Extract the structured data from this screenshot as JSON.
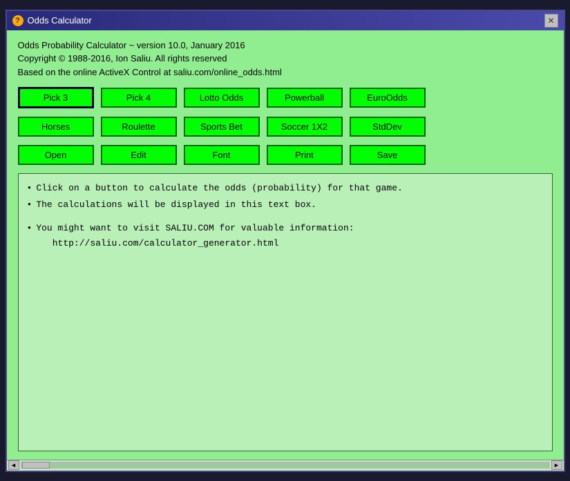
{
  "window": {
    "title": "Odds Calculator",
    "close_label": "✕"
  },
  "header": {
    "line1": "Odds Probability Calculator ~ version 10.0, January 2016",
    "line2": "Copyright © 1988-2016, Ion Saliu. All rights reserved",
    "line3": "Based on the online ActiveX Control at saliu.com/online_odds.html"
  },
  "buttons": {
    "row1": [
      {
        "id": "pick3",
        "label": "Pick 3",
        "selected": true
      },
      {
        "id": "pick4",
        "label": "Pick 4",
        "selected": false
      },
      {
        "id": "lotto",
        "label": "Lotto Odds",
        "selected": false
      },
      {
        "id": "powerball",
        "label": "Powerball",
        "selected": false
      },
      {
        "id": "euroOdds",
        "label": "EuroOdds",
        "selected": false
      }
    ],
    "row2": [
      {
        "id": "horses",
        "label": "Horses",
        "selected": false
      },
      {
        "id": "roulette",
        "label": "Roulette",
        "selected": false
      },
      {
        "id": "sportsBet",
        "label": "Sports Bet",
        "selected": false
      },
      {
        "id": "soccer",
        "label": "Soccer 1X2",
        "selected": false
      },
      {
        "id": "stdDev",
        "label": "StdDev",
        "selected": false
      }
    ],
    "row3": [
      {
        "id": "open",
        "label": "Open",
        "selected": false
      },
      {
        "id": "edit",
        "label": "Edit",
        "selected": false
      },
      {
        "id": "font",
        "label": "Font",
        "selected": false
      },
      {
        "id": "print",
        "label": "Print",
        "selected": false
      },
      {
        "id": "save",
        "label": "Save",
        "selected": false
      }
    ]
  },
  "textarea": {
    "lines": [
      "Click on a button to calculate the odds (probability) for that game.",
      "The calculations will be displayed in this text box.",
      "",
      "You might want to visit SALIU.COM for valuable information:",
      "http://saliu.com/calculator_generator.html"
    ]
  },
  "scrollbar": {
    "left_arrow": "◄",
    "right_arrow": "►"
  }
}
